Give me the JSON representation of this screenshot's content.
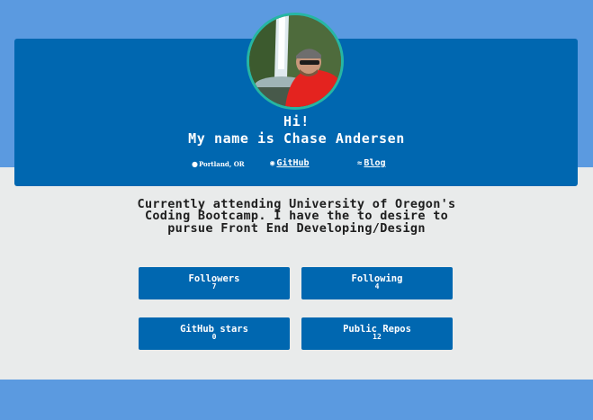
{
  "profile": {
    "greeting": "Hi!",
    "name_line": "My name is Chase Andersen",
    "avatar_alt": "profile photo",
    "location": "Portland, OR",
    "github_label": "GitHub",
    "blog_label": "Blog",
    "bio": "Currently attending University of Oregon's Coding Bootcamp. I have the to desire to pursue Front End Developing/Design"
  },
  "stats": [
    {
      "label": "Followers",
      "value": "7"
    },
    {
      "label": "Following",
      "value": "4"
    },
    {
      "label": "GitHub stars",
      "value": "0"
    },
    {
      "label": "Public Repos",
      "value": "12"
    }
  ],
  "icons": {
    "location": "map-marker-icon",
    "github": "github-icon",
    "blog": "rss-icon"
  },
  "colors": {
    "background": "#5b9ae0",
    "card": "#0067b0",
    "content_band": "#e9ebeb",
    "avatar_border": "#26b6a3"
  }
}
